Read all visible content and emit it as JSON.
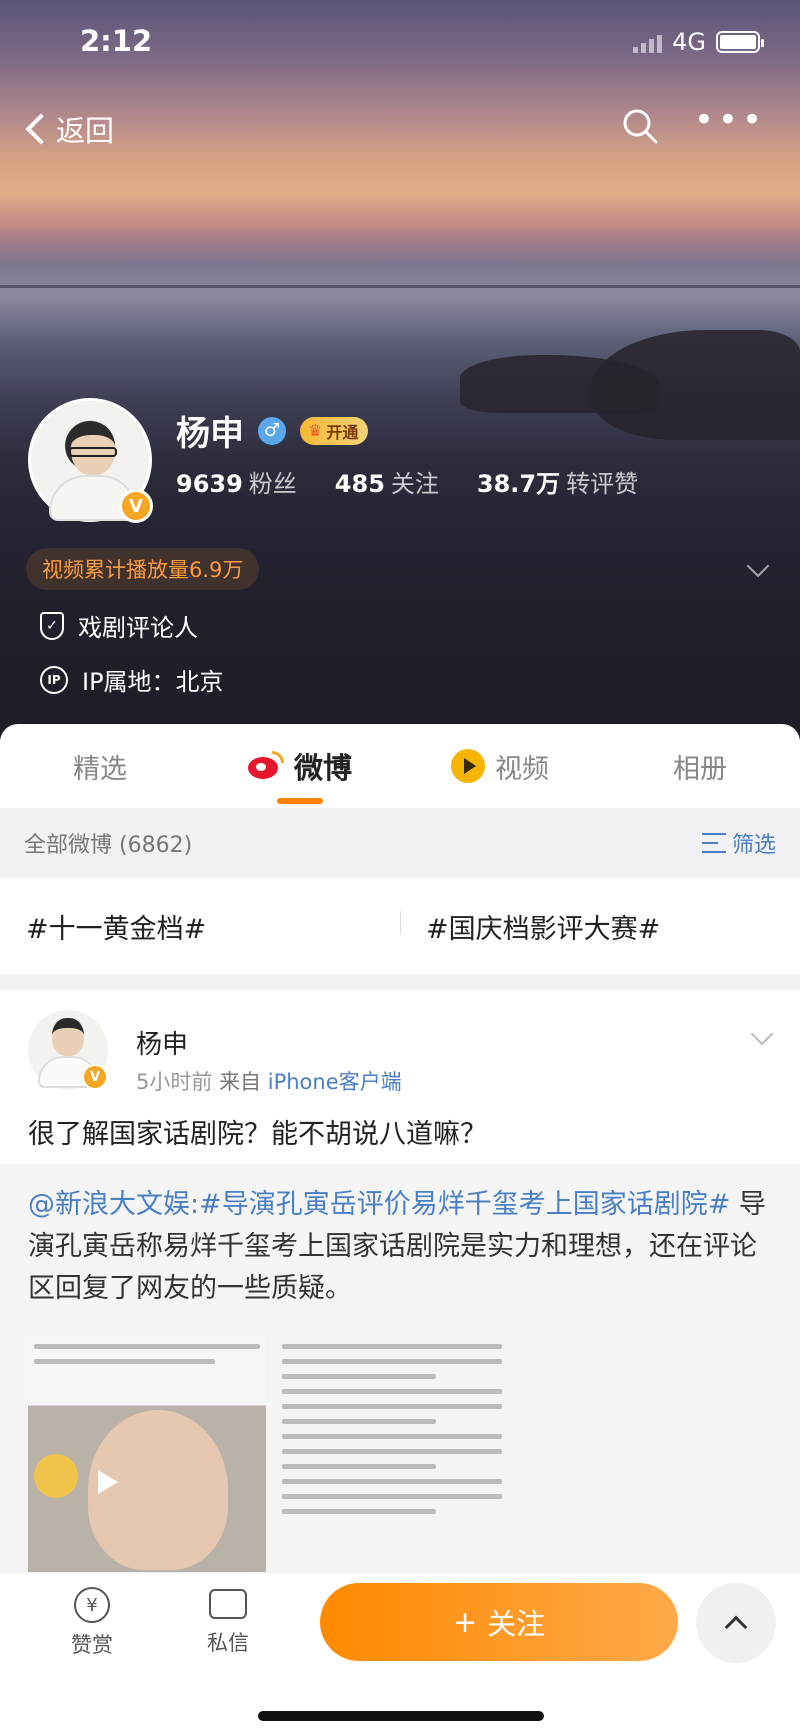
{
  "status_bar": {
    "time": "2:12",
    "network": "4G"
  },
  "nav": {
    "back_label": "返回"
  },
  "profile": {
    "name": "杨申",
    "vip_label": "开通",
    "stats": [
      {
        "num": "9639",
        "label": "粉丝"
      },
      {
        "num": "485",
        "label": "关注"
      },
      {
        "num": "38.7万",
        "label": "转评赞"
      }
    ],
    "play_count": "视频累计播放量6.9万",
    "title": "戏剧评论人",
    "ip_location": "IP属地：北京"
  },
  "tabs": [
    "精选",
    "微博",
    "视频",
    "相册"
  ],
  "filter": {
    "all_label": "全部微博 (6862)",
    "filter_label": "筛选"
  },
  "topics": [
    "#十一黄金档#",
    "#国庆档影评大赛#"
  ],
  "post": {
    "author": "杨申",
    "time": "5小时前",
    "source_prefix": "来自",
    "source": "iPhone客户端",
    "text": "很了解国家话剧院？能不胡说八道嘛？",
    "repost_link": "@新浪大文娱:#导演孔寅岳评价易烊千玺考上国家话剧院#",
    "repost_text": " 导演孔寅岳称易烊千玺考上国家话剧院是实力和理想，还在评论区回复了网友的一些质疑。"
  },
  "bottom": {
    "reward_label": "赞赏",
    "message_label": "私信",
    "follow_label": "关注"
  },
  "colors": {
    "accent": "#ff8200",
    "link": "#4a7fc6",
    "vip": "#f7b733"
  }
}
